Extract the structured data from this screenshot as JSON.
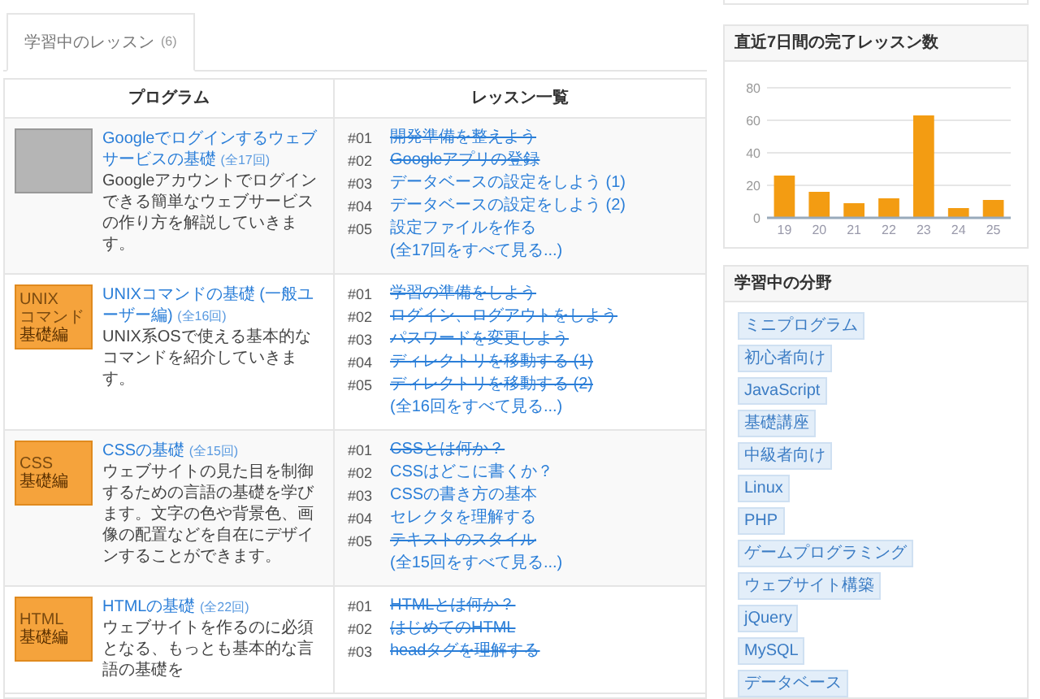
{
  "tab": {
    "label": "学習中のレッスン",
    "count": "(6)",
    "selected": true
  },
  "table": {
    "columns": [
      "プログラム",
      "レッスン一覧"
    ],
    "rows": [
      {
        "thumbnail": {
          "kind": "picture"
        },
        "title": "Googleでログインするウェブサービスの基礎",
        "count": "(全17回)",
        "description": "Googleアカウントでログインできる簡単なウェブサービスの作り方を解説していきます。",
        "lessons": [
          {
            "number": "#01",
            "title": "開発準備を整えよう",
            "done": true
          },
          {
            "number": "#02",
            "title": "Googleアプリの登録",
            "done": true
          },
          {
            "number": "#03",
            "title": "データベースの設定をしよう (1)",
            "done": false
          },
          {
            "number": "#04",
            "title": "データベースの設定をしよう (2)",
            "done": false
          },
          {
            "number": "#05",
            "title": "設定ファイルを作る",
            "done": false
          }
        ],
        "more": "(全17回をすべて見る...)"
      },
      {
        "thumbnail": {
          "kind": "label",
          "lines": [
            "UNIX",
            "コマンド",
            "基礎編"
          ]
        },
        "title": "UNIXコマンドの基礎 (一般ユーザー編)",
        "count": "(全16回)",
        "description": "UNIX系OSで使える基本的なコマンドを紹介していきます。",
        "lessons": [
          {
            "number": "#01",
            "title": "学習の準備をしよう",
            "done": true
          },
          {
            "number": "#02",
            "title": "ログイン、ログアウトをしよう",
            "done": true
          },
          {
            "number": "#03",
            "title": "パスワードを変更しよう",
            "done": true
          },
          {
            "number": "#04",
            "title": "ディレクトリを移動する (1)",
            "done": true
          },
          {
            "number": "#05",
            "title": "ディレクトリを移動する (2)",
            "done": true
          }
        ],
        "more": "(全16回をすべて見る...)"
      },
      {
        "thumbnail": {
          "kind": "label",
          "lines": [
            "CSS",
            "基礎編"
          ]
        },
        "title": "CSSの基礎",
        "count": "(全15回)",
        "description": "ウェブサイトの見た目を制御するための言語の基礎を学びます。文字の色や背景色、画像の配置などを自在にデザインすることができます。",
        "lessons": [
          {
            "number": "#01",
            "title": "CSSとは何か？",
            "done": true
          },
          {
            "number": "#02",
            "title": "CSSはどこに書くか？",
            "done": false
          },
          {
            "number": "#03",
            "title": "CSSの書き方の基本",
            "done": false
          },
          {
            "number": "#04",
            "title": "セレクタを理解する",
            "done": false
          },
          {
            "number": "#05",
            "title": "テキストのスタイル",
            "done": true
          }
        ],
        "more": "(全15回をすべて見る...)"
      },
      {
        "thumbnail": {
          "kind": "label",
          "lines": [
            "HTML",
            "基礎編"
          ]
        },
        "title": "HTMLの基礎",
        "count": "(全22回)",
        "description": "ウェブサイトを作るのに必須となる、もっとも基本的な言語の基礎を",
        "lessons": [
          {
            "number": "#01",
            "title": "HTMLとは何か？",
            "done": true
          },
          {
            "number": "#02",
            "title": "はじめてのHTML",
            "done": true
          },
          {
            "number": "#03",
            "title": "headタグを理解する",
            "done": true
          }
        ]
      }
    ]
  },
  "chart_panel": {
    "title": "直近7日間の完了レッスン数",
    "chart_data": {
      "type": "bar",
      "categories": [
        "19",
        "20",
        "21",
        "22",
        "23",
        "24",
        "25"
      ],
      "grid": true,
      "series": [
        {
          "color": "#f39c12",
          "values": [
            26,
            16,
            9,
            12,
            63,
            6,
            11
          ]
        }
      ],
      "ylim": [
        0,
        80
      ],
      "yticks": [
        0,
        20,
        40,
        60,
        80
      ]
    }
  },
  "fields_panel": {
    "title": "学習中の分野",
    "tags": [
      "ミニプログラム",
      "初心者向け",
      "JavaScript",
      "基礎講座",
      "中級者向け",
      "Linux",
      "PHP",
      "ゲームプログラミング",
      "ウェブサイト構築",
      "jQuery",
      "MySQL",
      "データベース"
    ]
  }
}
